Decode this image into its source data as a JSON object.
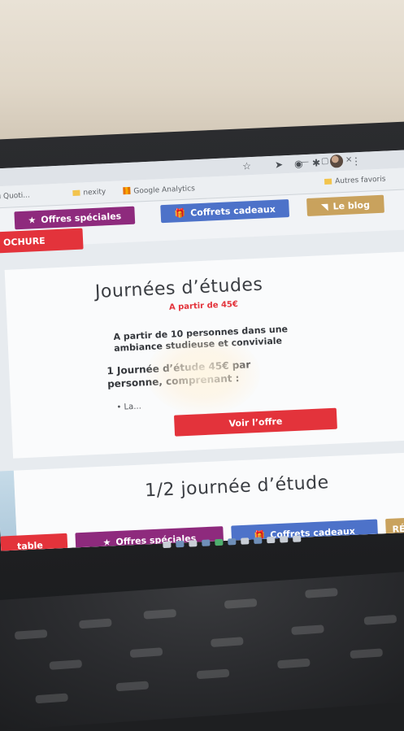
{
  "browser": {
    "bookmarks": [
      {
        "label": "e au Quoti..."
      },
      {
        "label": "nexity"
      },
      {
        "label": "Google Analytics"
      },
      {
        "label": "Autres favoris"
      }
    ],
    "toolbar_icons": [
      "star-icon",
      "send-icon",
      "circle-icon",
      "extensions-icon",
      "avatar",
      "menu-icon"
    ]
  },
  "nav_top": {
    "offres": "Offres spéciales",
    "coffrets": "Coffrets cadeaux",
    "blog": "Le blog",
    "brochure": "OCHURE"
  },
  "card1": {
    "title": "Journées d’études",
    "price": "A partir de 45€",
    "line1": "A partir de 10 personnes dans une",
    "line2": "ambiance studieuse et conviviale",
    "line3": "1 Journée d’étude 45€ par",
    "line4": "personne, comprenant :",
    "bullet": "• La...",
    "cta": "Voir l’offre"
  },
  "card2": {
    "title": "1/2 journée d’étude"
  },
  "nav_bottom": {
    "table": "table",
    "offres": "Offres spéciales",
    "coffrets": "Coffrets cadeaux",
    "reserve": "RÉSE"
  },
  "colors": {
    "purple": "#8e2a7d",
    "blue": "#4d72c9",
    "gold": "#c9a25d",
    "red": "#e3333b"
  }
}
